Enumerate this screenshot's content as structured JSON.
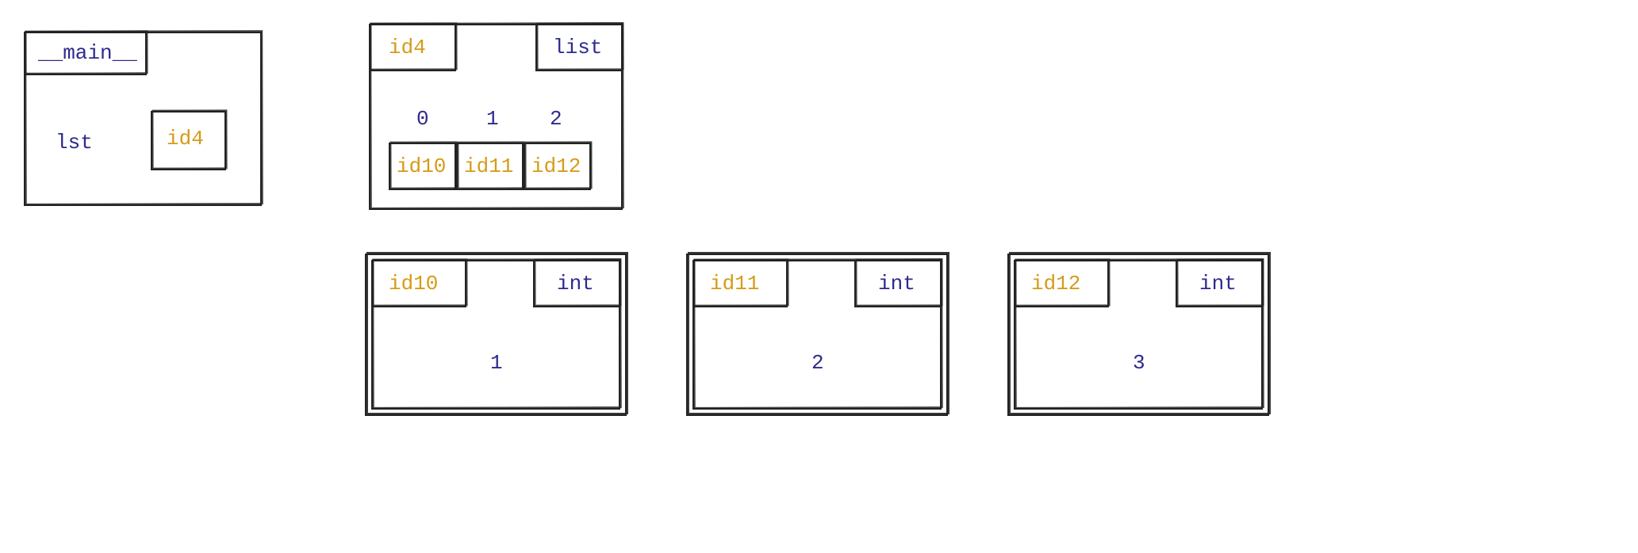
{
  "frame": {
    "name": "__main__",
    "vars": [
      {
        "name": "lst",
        "ref": "id4"
      }
    ]
  },
  "objects": {
    "id4": {
      "id": "id4",
      "type": "list",
      "indices": [
        "0",
        "1",
        "2"
      ],
      "items": [
        "id10",
        "id11",
        "id12"
      ]
    },
    "id10": {
      "id": "id10",
      "type": "int",
      "value": "1"
    },
    "id11": {
      "id": "id11",
      "type": "int",
      "value": "2"
    },
    "id12": {
      "id": "id12",
      "type": "int",
      "value": "3"
    }
  }
}
